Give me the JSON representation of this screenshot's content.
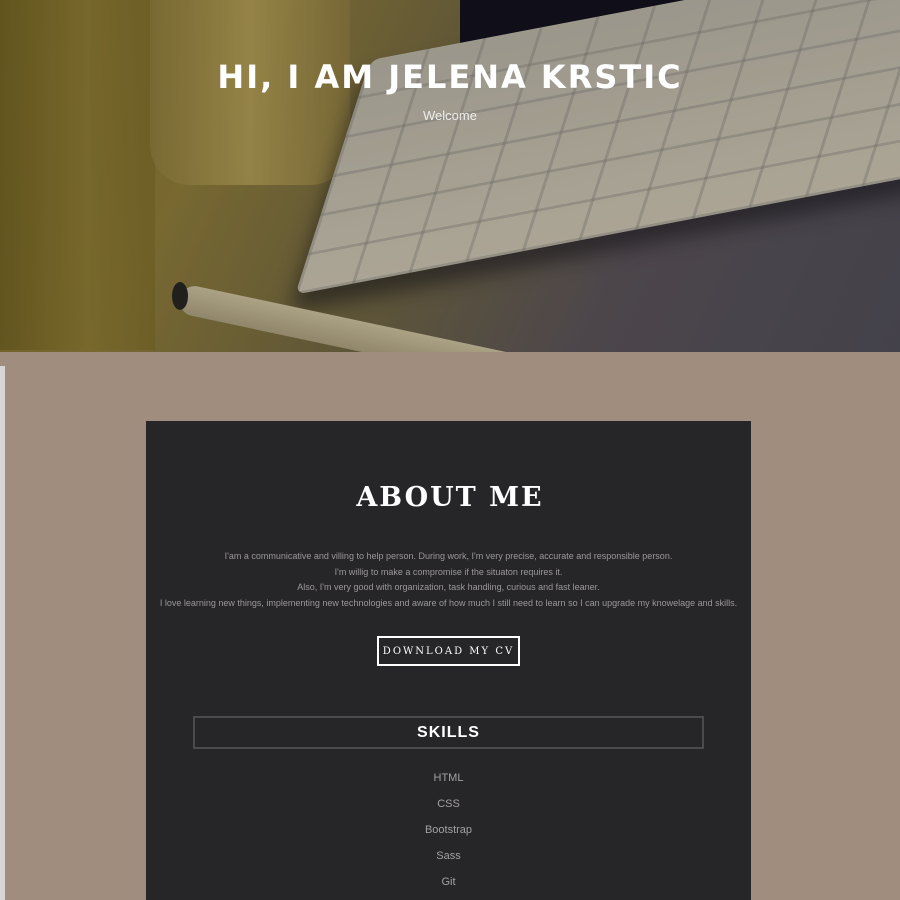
{
  "hero": {
    "title": "HI, I AM JELENA KRSTIC",
    "subtitle": "Welcome"
  },
  "about": {
    "title": "ABOUT ME",
    "lines": [
      "I'am a communicative and villing to help person. During work, I'm very precise, accurate and responsible person.",
      "I'm willig to make a compromise if the situaton requires it.",
      "Also, I'm very good with organization, task handling, curious and fast leaner.",
      "I love learning new things, implementing new technologies and aware of how much I still need to learn so I can upgrade my knowelage and skills."
    ],
    "cv_button": "DOWNLOAD MY CV"
  },
  "skills": {
    "title": "SKILLS",
    "items": [
      "HTML",
      "CSS",
      "Bootstrap",
      "Sass",
      "Git"
    ]
  },
  "colors": {
    "background": "#a08d7e",
    "card": "#262528",
    "text": "#9b9898"
  }
}
